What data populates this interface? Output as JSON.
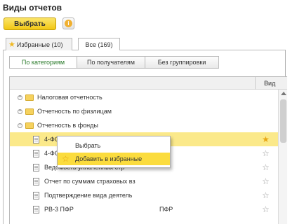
{
  "header": {
    "title": "Виды отчетов"
  },
  "toolbar": {
    "select_label": "Выбрать",
    "info_icon": "info-icon"
  },
  "tabs": [
    {
      "label": "Избранные (10)",
      "active": false
    },
    {
      "label": "Все (169)",
      "active": true
    }
  ],
  "grouping": [
    {
      "label": "По категориям",
      "active": true
    },
    {
      "label": "По получателям",
      "active": false
    },
    {
      "label": "Без группировки",
      "active": false
    }
  ],
  "list": {
    "column_header": "Вид",
    "rows": [
      {
        "type": "folder",
        "label": "Налоговая отчетность"
      },
      {
        "type": "folder",
        "label": "Отчетность по физлицам"
      },
      {
        "type": "folder",
        "label": "Отчетность в фонды"
      },
      {
        "type": "doc",
        "label": "4-ФС",
        "selected": true,
        "favorite": true
      },
      {
        "type": "doc",
        "label": "4-ФС",
        "favorite": false
      },
      {
        "type": "doc",
        "label": "Ведомость уплаченных стр",
        "favorite": false
      },
      {
        "type": "doc",
        "label": "Отчет по суммам страховых вз",
        "favorite": false
      },
      {
        "type": "doc",
        "label": "Подтверждение вида деятель",
        "favorite": false
      },
      {
        "type": "doc",
        "label": "РВ-3 ПФР",
        "extra": "ПФР",
        "favorite": false
      }
    ]
  },
  "context_menu": {
    "items": [
      {
        "label": "Выбрать"
      },
      {
        "label": "Добавить в избранные",
        "highlighted": true
      }
    ]
  },
  "colors": {
    "accent": "#f2c714",
    "selection": "#fbe98a",
    "star": "#e8a816"
  }
}
